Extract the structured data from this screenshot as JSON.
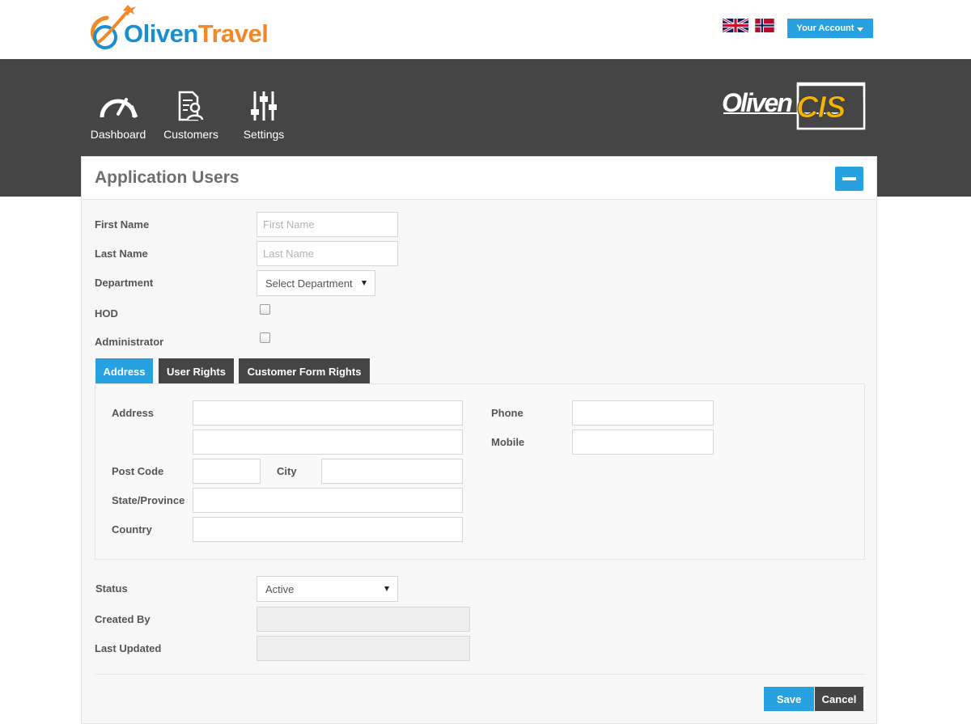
{
  "brand": {
    "logo_part1": "Oliven",
    "logo_part2": "Travel",
    "cis_logo_part1": "Oliven",
    "cis_logo_part2": "CIS"
  },
  "header": {
    "account_label": "Your Account",
    "flags": [
      "uk-flag",
      "norway-flag"
    ]
  },
  "nav": {
    "items": [
      {
        "label": "Dashboard",
        "icon": "speedometer-icon"
      },
      {
        "label": "Customers",
        "icon": "customer-document-icon"
      },
      {
        "label": "Settings",
        "icon": "sliders-icon"
      }
    ]
  },
  "panel": {
    "title": "Application Users"
  },
  "form": {
    "first_name": {
      "label": "First Name",
      "placeholder": "First Name",
      "value": ""
    },
    "last_name": {
      "label": "Last Name",
      "placeholder": "Last Name",
      "value": ""
    },
    "department": {
      "label": "Department",
      "selected": "Select Department"
    },
    "hod": {
      "label": "HOD",
      "checked": false
    },
    "administrator": {
      "label": "Administrator",
      "checked": false
    }
  },
  "tabs": [
    {
      "label": "Address",
      "active": true
    },
    {
      "label": "User Rights",
      "active": false
    },
    {
      "label": "Customer Form Rights",
      "active": false
    }
  ],
  "address_tab": {
    "address_label": "Address",
    "post_code_label": "Post Code",
    "city_label": "City",
    "state_label": "State/Province",
    "country_label": "Country",
    "phone_label": "Phone",
    "mobile_label": "Mobile"
  },
  "footer_form": {
    "status": {
      "label": "Status",
      "selected": "Active"
    },
    "created_by": {
      "label": "Created By",
      "value": ""
    },
    "last_updated": {
      "label": "Last Updated",
      "value": ""
    }
  },
  "actions": {
    "save_label": "Save",
    "cancel_label": "Cancel"
  },
  "colors": {
    "accent": "#27a1e0",
    "dark": "#454545",
    "logo_blue": "#1a8fd0",
    "logo_orange": "#f0892a",
    "cis_yellow": "#f5b400"
  }
}
